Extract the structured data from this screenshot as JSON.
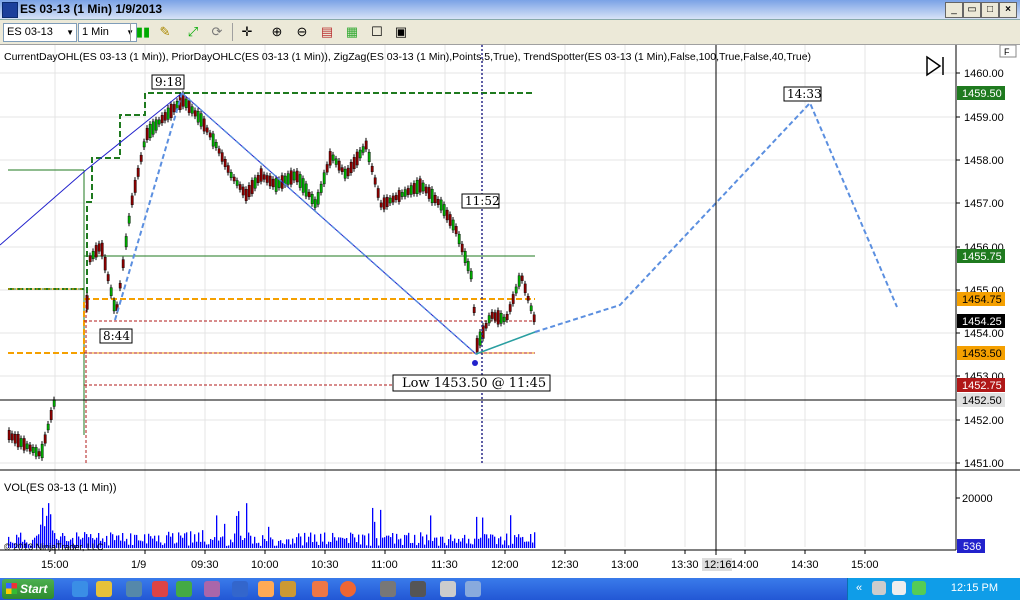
{
  "window": {
    "title": "ES 03-13 (1 Min)  1/9/2013"
  },
  "toolbar": {
    "instrument": "ES 03-13",
    "interval": "1 Min"
  },
  "chart": {
    "indicators_label": "CurrentDayOHL(ES 03-13 (1 Min)), PriorDayOHLC(ES 03-13 (1 Min)), ZigZag(ES 03-13 (1 Min),Points,5,True), TrendSpotter(ES 03-13 (1 Min),False,100,True,False,40,True)",
    "f_label": "F",
    "annotations": {
      "high_time": "9:18",
      "low_time": "8:44",
      "mid_time": "11:52",
      "proj_time": "14:33",
      "low_text": "Low 1453.50 @ 11:45"
    },
    "price_ticks": [
      "1460.00",
      "1459.00",
      "1458.00",
      "1457.00",
      "1456.00",
      "1455.00",
      "1454.00",
      "1453.00",
      "1452.00",
      "1451.00"
    ],
    "price_flags": [
      {
        "label": "1459.50",
        "bg": "#1f7a1f",
        "fg": "#ffffff"
      },
      {
        "label": "1455.75",
        "bg": "#1f7a1f",
        "fg": "#ffffff"
      },
      {
        "label": "1454.75",
        "bg": "#f5a000",
        "fg": "#000000"
      },
      {
        "label": "1454.25",
        "bg": "#000000",
        "fg": "#ffffff"
      },
      {
        "label": "1453.50",
        "bg": "#f5a000",
        "fg": "#000000"
      },
      {
        "label": "1452.75",
        "bg": "#b01818",
        "fg": "#ffffff"
      },
      {
        "label": "1452.50",
        "bg": "#e0e0e0",
        "fg": "#000000"
      }
    ],
    "time_ticks": [
      "15:00",
      "1/9",
      "09:30",
      "10:00",
      "10:30",
      "11:00",
      "11:30",
      "12:00",
      "12:30",
      "13:00",
      "13:30",
      "14:00",
      "14:30",
      "15:00"
    ],
    "crosshair_time": "12:16",
    "volume_label": "VOL(ES 03-13 (1 Min))",
    "volume_tick": "20000",
    "volume_flag": "536",
    "copyright": "© 2013 NinjaTrader, LLC"
  },
  "taskbar": {
    "start": "Start",
    "clock": "12:15 PM"
  },
  "colors": {
    "bull_up": "#00aa00",
    "bear": "#8b0000",
    "zigzag": "#2222cc",
    "projection": "#5b8fe0",
    "prior": "#f5a000",
    "current": "#1f7a1f",
    "volume": "#0000ff"
  }
}
